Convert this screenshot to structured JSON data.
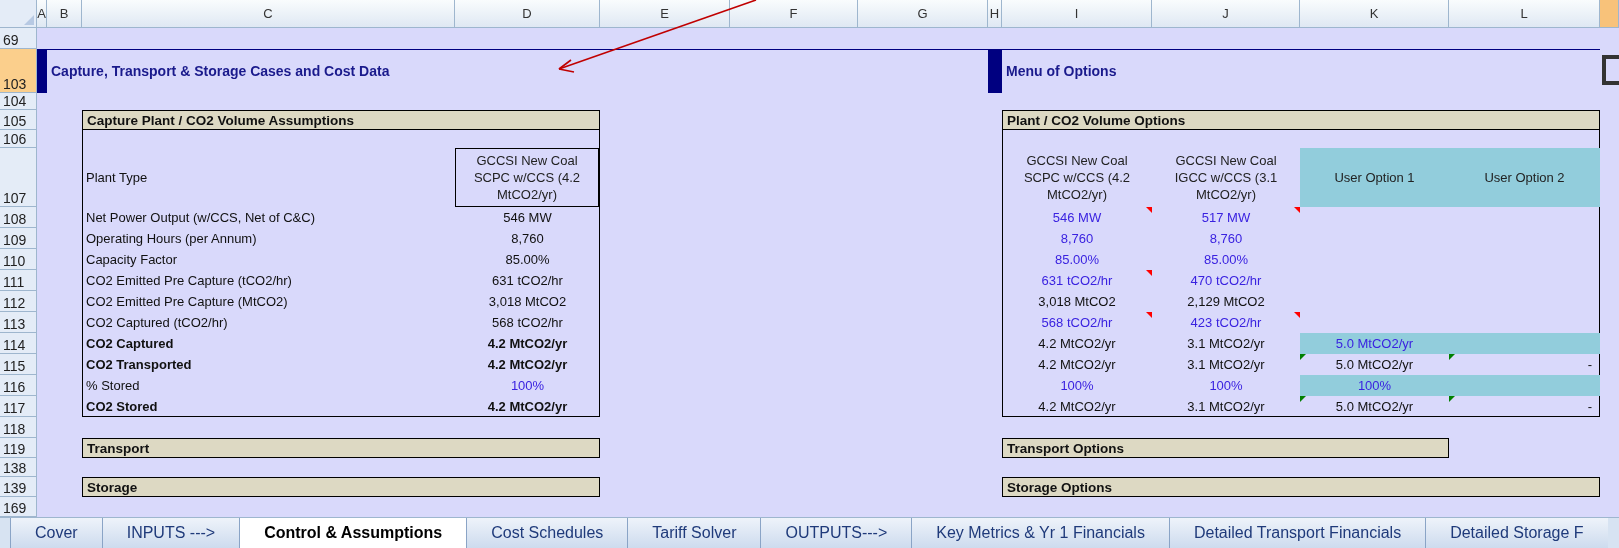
{
  "column_headers": [
    "A",
    "B",
    "C",
    "D",
    "E",
    "F",
    "G",
    "H",
    "I",
    "J",
    "K",
    "L"
  ],
  "row_numbers": [
    {
      "label": "69",
      "selected": false
    },
    {
      "label": "103",
      "selected": true
    },
    {
      "label": "104",
      "selected": false
    },
    {
      "label": "105",
      "selected": false
    },
    {
      "label": "106",
      "selected": false
    },
    {
      "label": "107",
      "selected": false
    },
    {
      "label": "108",
      "selected": false
    },
    {
      "label": "109",
      "selected": false
    },
    {
      "label": "110",
      "selected": false
    },
    {
      "label": "111",
      "selected": false
    },
    {
      "label": "112",
      "selected": false
    },
    {
      "label": "113",
      "selected": false
    },
    {
      "label": "114",
      "selected": false
    },
    {
      "label": "115",
      "selected": false
    },
    {
      "label": "116",
      "selected": false
    },
    {
      "label": "117",
      "selected": false
    },
    {
      "label": "118",
      "selected": false
    },
    {
      "label": "119",
      "selected": false
    },
    {
      "label": "138",
      "selected": false
    },
    {
      "label": "139",
      "selected": false
    },
    {
      "label": "169",
      "selected": false
    }
  ],
  "left_section": {
    "title": "Capture, Transport & Storage Cases and Cost Data"
  },
  "right_section": {
    "title": "Menu of Options"
  },
  "assumptions": {
    "title": "Capture Plant / CO2 Volume Assumptions",
    "header_label": "Plant Type",
    "header_value": "GCCSI New Coal SCPC w/CCS (4.2 MtCO2/yr)",
    "rows": [
      {
        "label": "Net Power Output (w/CCS, Net of C&C)",
        "value": "546 MW",
        "bold": false,
        "input": false
      },
      {
        "label": "Operating Hours (per Annum)",
        "value": "8,760",
        "bold": false,
        "input": false
      },
      {
        "label": "Capacity Factor",
        "value": "85.00%",
        "bold": false,
        "input": false
      },
      {
        "label": "CO2 Emitted Pre Capture (tCO2/hr)",
        "value": "631 tCO2/hr",
        "bold": false,
        "input": false
      },
      {
        "label": "CO2 Emitted Pre Capture (MtCO2)",
        "value": "3,018 MtCO2",
        "bold": false,
        "input": false
      },
      {
        "label": "CO2 Captured (tCO2/hr)",
        "value": "568 tCO2/hr",
        "bold": false,
        "input": false
      },
      {
        "label": "CO2 Captured",
        "value": "4.2 MtCO2/yr",
        "bold": true,
        "input": false
      },
      {
        "label": "CO2 Transported",
        "value": "4.2 MtCO2/yr",
        "bold": true,
        "input": false
      },
      {
        "label": "% Stored",
        "value": "100%",
        "bold": false,
        "input": true
      },
      {
        "label": "CO2 Stored",
        "value": "4.2 MtCO2/yr",
        "bold": true,
        "input": false
      }
    ]
  },
  "options": {
    "title": "Plant / CO2 Volume Options",
    "columns": [
      {
        "label": "GCCSI New Coal SCPC w/CCS (4.2 MtCO2/yr)",
        "highlight": false
      },
      {
        "label": "GCCSI New Coal IGCC w/CCS (3.1 MtCO2/yr)",
        "highlight": false
      },
      {
        "label": "User Option 1",
        "highlight": true
      },
      {
        "label": "User Option 2",
        "highlight": true
      }
    ],
    "rows": [
      {
        "I": {
          "value": "546 MW",
          "input": true,
          "comment": true,
          "flag": false,
          "highlight": false
        },
        "J": {
          "value": "517 MW",
          "input": true,
          "comment": true,
          "flag": false,
          "highlight": false
        }
      },
      {
        "I": {
          "value": "8,760",
          "input": true,
          "comment": false,
          "flag": false,
          "highlight": false
        },
        "J": {
          "value": "8,760",
          "input": true,
          "comment": false,
          "flag": false,
          "highlight": false
        }
      },
      {
        "I": {
          "value": "85.00%",
          "input": true,
          "comment": false,
          "flag": false,
          "highlight": false
        },
        "J": {
          "value": "85.00%",
          "input": true,
          "comment": false,
          "flag": false,
          "highlight": false
        }
      },
      {
        "I": {
          "value": "631 tCO2/hr",
          "input": true,
          "comment": true,
          "flag": false,
          "highlight": false
        },
        "J": {
          "value": "470 tCO2/hr",
          "input": true,
          "comment": false,
          "flag": false,
          "highlight": false
        }
      },
      {
        "I": {
          "value": "3,018 MtCO2",
          "input": false,
          "comment": false,
          "flag": false,
          "highlight": false
        },
        "J": {
          "value": "2,129 MtCO2",
          "input": false,
          "comment": false,
          "flag": false,
          "highlight": false
        }
      },
      {
        "I": {
          "value": "568 tCO2/hr",
          "input": true,
          "comment": true,
          "flag": false,
          "highlight": false
        },
        "J": {
          "value": "423 tCO2/hr",
          "input": true,
          "comment": true,
          "flag": false,
          "highlight": false
        }
      },
      {
        "I": {
          "value": "4.2 MtCO2/yr",
          "input": false,
          "comment": false,
          "flag": false,
          "highlight": false
        },
        "J": {
          "value": "3.1 MtCO2/yr",
          "input": false,
          "comment": false,
          "flag": false,
          "highlight": false
        },
        "K": {
          "value": "5.0 MtCO2/yr",
          "input": true,
          "comment": false,
          "flag": false,
          "highlight": true
        },
        "L": {
          "comment": false,
          "flag": false,
          "highlight": true
        }
      },
      {
        "I": {
          "value": "4.2 MtCO2/yr",
          "input": false,
          "comment": false,
          "flag": false,
          "highlight": false
        },
        "J": {
          "value": "3.1 MtCO2/yr",
          "input": false,
          "comment": false,
          "flag": false,
          "highlight": false
        },
        "K": {
          "value": "5.0 MtCO2/yr",
          "input": false,
          "comment": false,
          "flag": true,
          "highlight": false
        },
        "L": {
          "value": "-",
          "input": false,
          "comment": false,
          "flag": true,
          "highlight": false
        }
      },
      {
        "I": {
          "value": "100%",
          "input": true,
          "comment": false,
          "flag": false,
          "highlight": false
        },
        "J": {
          "value": "100%",
          "input": true,
          "comment": false,
          "flag": false,
          "highlight": false
        },
        "K": {
          "value": "100%",
          "input": true,
          "comment": false,
          "flag": false,
          "highlight": true
        },
        "L": {
          "comment": false,
          "flag": false,
          "highlight": true
        }
      },
      {
        "I": {
          "value": "4.2 MtCO2/yr",
          "input": false,
          "comment": false,
          "flag": false,
          "highlight": false
        },
        "J": {
          "value": "3.1 MtCO2/yr",
          "input": false,
          "comment": false,
          "flag": false,
          "highlight": false
        },
        "K": {
          "value": "5.0 MtCO2/yr",
          "input": false,
          "comment": false,
          "flag": true,
          "highlight": false
        },
        "L": {
          "value": "-",
          "input": false,
          "comment": false,
          "flag": true,
          "highlight": false
        }
      }
    ]
  },
  "bands": [
    {
      "title": "Transport"
    },
    {
      "title": "Storage"
    },
    {
      "title": "Transport Options"
    },
    {
      "title": "Storage Options"
    }
  ],
  "sheet_tabs": [
    {
      "label": "Cover",
      "selected": false
    },
    {
      "label": "INPUTS --->",
      "selected": false
    },
    {
      "label": "Control & Assumptions",
      "selected": true
    },
    {
      "label": "Cost Schedules",
      "selected": false
    },
    {
      "label": "Tariff Solver",
      "selected": false
    },
    {
      "label": "OUTPUTS--->",
      "selected": false
    },
    {
      "label": "Key Metrics & Yr 1 Financials",
      "selected": false
    },
    {
      "label": "Detailed Transport Financials",
      "selected": false
    },
    {
      "label": "Detailed Storage F",
      "selected": false
    }
  ]
}
